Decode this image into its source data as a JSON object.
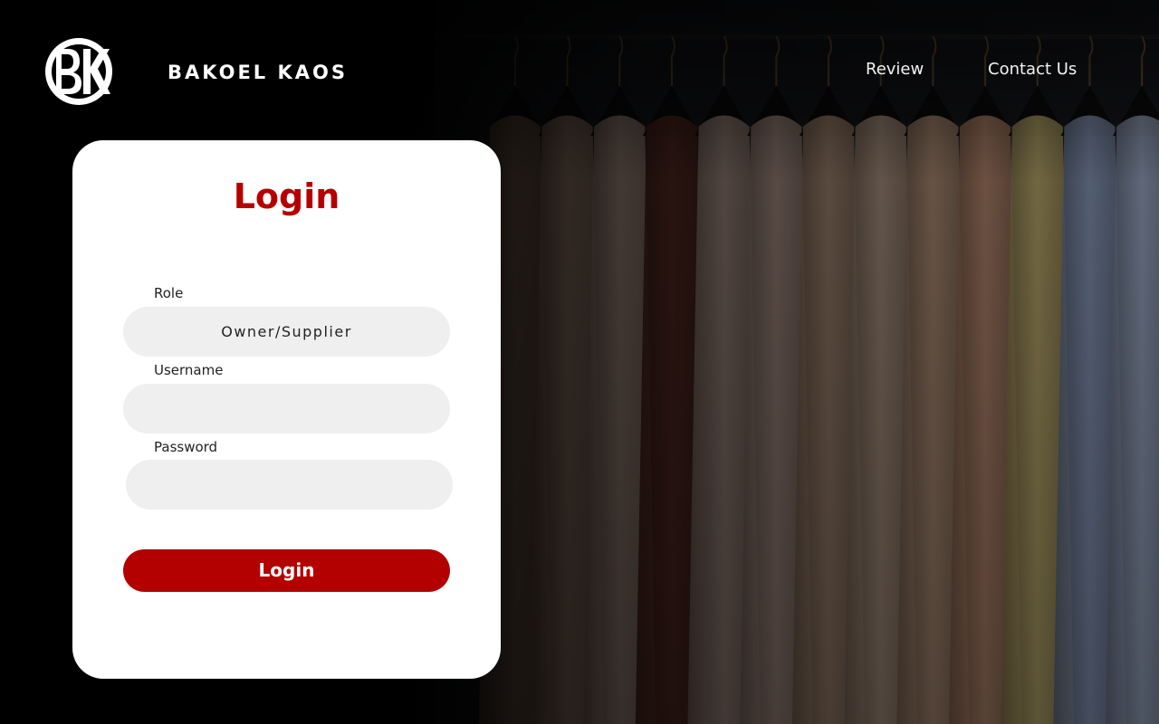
{
  "header": {
    "logo": {
      "icon": "bk-monogram-logo-icon",
      "text": "BK"
    },
    "brand_name": "BAKOEL KAOS",
    "nav": [
      {
        "label": "Review"
      },
      {
        "label": "Contact Us"
      }
    ]
  },
  "login_card": {
    "title": "Login",
    "fields": {
      "role": {
        "label": "Role",
        "value": "Owner/Supplier"
      },
      "username": {
        "label": "Username",
        "value": "",
        "placeholder": ""
      },
      "password": {
        "label": "Password",
        "value": "",
        "placeholder": ""
      }
    },
    "submit_label": "Login"
  },
  "background": {
    "subject": "clothing-rack-photo",
    "garments": [
      {
        "color": "#b78f72"
      },
      {
        "color": "#d8ad92"
      },
      {
        "color": "#e8c2ad"
      },
      {
        "color": "#7a3a2c"
      },
      {
        "color": "#e9c6b4"
      },
      {
        "color": "#f0c9b8"
      },
      {
        "color": "#e7bd9d"
      },
      {
        "color": "#f1cdb0"
      },
      {
        "color": "#efc09e"
      },
      {
        "color": "#f1b28d"
      },
      {
        "color": "#f2d98a"
      },
      {
        "color": "#a9bde6"
      },
      {
        "color": "#b9c9ea"
      }
    ]
  },
  "colors": {
    "accent": "#b30000",
    "title": "#b50000",
    "field_bg": "#efefef",
    "card_bg": "#ffffff",
    "page_bg": "#000000"
  }
}
